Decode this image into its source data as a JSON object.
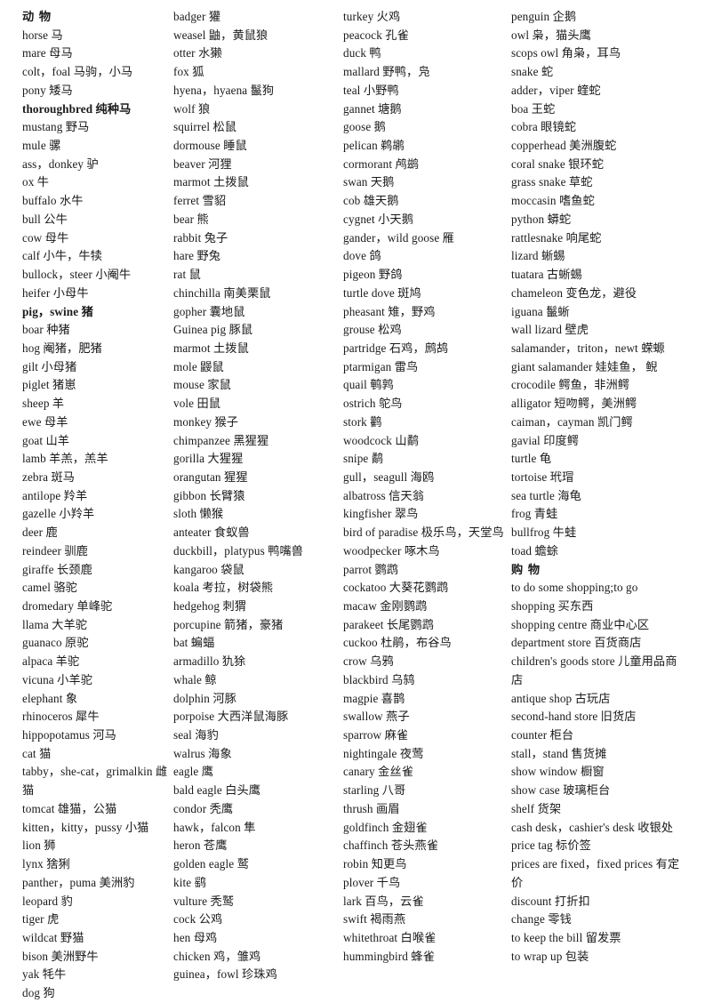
{
  "document": {
    "title": "动  物 / 购  物 English-Chinese vocabulary list",
    "section_headings": [
      "动  物",
      "购  物"
    ],
    "layout": {
      "columns": 4,
      "text_color": "#1a1a1a",
      "background": "#ffffff"
    }
  },
  "columns": [
    {
      "index": 0,
      "entries": [
        {
          "text": "动  物",
          "style": "heading"
        },
        {
          "text": "horse  马",
          "style": "normal"
        },
        {
          "text": "mare  母马",
          "style": "normal"
        },
        {
          "text": "colt，foal  马驹，小马",
          "style": "normal"
        },
        {
          "text": "pony  矮马",
          "style": "normal"
        },
        {
          "text": "thoroughbred  纯种马",
          "style": "bold"
        },
        {
          "text": "mustang  野马",
          "style": "normal"
        },
        {
          "text": "mule  骡",
          "style": "normal"
        },
        {
          "text": "ass，donkey  驴",
          "style": "normal"
        },
        {
          "text": "ox  牛",
          "style": "normal"
        },
        {
          "text": "buffalo  水牛",
          "style": "normal"
        },
        {
          "text": "bull  公牛",
          "style": "normal"
        },
        {
          "text": "cow  母牛",
          "style": "normal"
        },
        {
          "text": "calf  小牛，牛犊",
          "style": "normal"
        },
        {
          "text": "bullock，steer  小阉牛",
          "style": "normal"
        },
        {
          "text": "heifer  小母牛",
          "style": "normal"
        },
        {
          "text": "pig，swine  猪",
          "style": "bold"
        },
        {
          "text": "boar  种猪",
          "style": "normal"
        },
        {
          "text": "hog  阉猪，肥猪",
          "style": "normal"
        },
        {
          "text": "gilt  小母猪",
          "style": "normal"
        },
        {
          "text": "piglet  猪崽",
          "style": "normal"
        },
        {
          "text": "sheep  羊",
          "style": "normal"
        },
        {
          "text": "ewe  母羊",
          "style": "normal"
        },
        {
          "text": "goat  山羊",
          "style": "normal"
        },
        {
          "text": "lamb  羊羔，羔羊",
          "style": "normal"
        },
        {
          "text": "zebra  斑马",
          "style": "normal"
        },
        {
          "text": "antilope  羚羊",
          "style": "normal"
        },
        {
          "text": "gazelle  小羚羊",
          "style": "normal"
        },
        {
          "text": "deer  鹿",
          "style": "normal"
        },
        {
          "text": "reindeer  驯鹿",
          "style": "normal"
        },
        {
          "text": "giraffe  长颈鹿",
          "style": "normal"
        },
        {
          "text": "camel  骆驼",
          "style": "normal"
        },
        {
          "text": "dromedary  单峰驼",
          "style": "normal"
        },
        {
          "text": "llama  大羊驼",
          "style": "normal"
        },
        {
          "text": "guanaco  原驼",
          "style": "normal"
        },
        {
          "text": "alpaca  羊驼",
          "style": "normal"
        },
        {
          "text": "vicuna  小羊驼",
          "style": "normal"
        },
        {
          "text": "elephant  象",
          "style": "normal"
        },
        {
          "text": "rhinoceros  犀牛",
          "style": "normal"
        },
        {
          "text": "hippopotamus  河马",
          "style": "normal"
        },
        {
          "text": "cat  猫",
          "style": "normal"
        },
        {
          "text": "tabby，she-cat，grimalkin  雌猫",
          "style": "normal"
        },
        {
          "text": "tomcat  雄猫，公猫",
          "style": "normal"
        },
        {
          "text": "kitten，kitty，pussy  小猫",
          "style": "normal"
        },
        {
          "text": "lion  狮",
          "style": "normal"
        },
        {
          "text": "lynx  猞猁",
          "style": "normal"
        },
        {
          "text": "panther，puma  美洲豹",
          "style": "normal"
        },
        {
          "text": "leopard  豹",
          "style": "normal"
        },
        {
          "text": "tiger  虎",
          "style": "normal"
        },
        {
          "text": "wildcat  野猫",
          "style": "normal"
        },
        {
          "text": "bison  美洲野牛",
          "style": "normal"
        },
        {
          "text": "yak  牦牛",
          "style": "normal"
        },
        {
          "text": "dog  狗",
          "style": "normal"
        }
      ]
    },
    {
      "index": 1,
      "entries": [
        {
          "text": "badger  獾",
          "style": "normal"
        },
        {
          "text": "weasel  鼬，黄鼠狼",
          "style": "normal"
        },
        {
          "text": "otter  水獭",
          "style": "normal"
        },
        {
          "text": "fox  狐",
          "style": "normal"
        },
        {
          "text": "hyena，hyaena  鬣狗",
          "style": "normal"
        },
        {
          "text": "wolf  狼",
          "style": "normal"
        },
        {
          "text": "squirrel  松鼠",
          "style": "normal"
        },
        {
          "text": "dormouse  睡鼠",
          "style": "normal"
        },
        {
          "text": "beaver  河狸",
          "style": "normal"
        },
        {
          "text": "marmot  土拨鼠",
          "style": "normal"
        },
        {
          "text": "ferret  雪貂",
          "style": "normal"
        },
        {
          "text": "bear  熊",
          "style": "normal"
        },
        {
          "text": "rabbit  兔子",
          "style": "normal"
        },
        {
          "text": "hare  野兔",
          "style": "normal"
        },
        {
          "text": "rat  鼠",
          "style": "normal"
        },
        {
          "text": "chinchilla  南美栗鼠",
          "style": "normal"
        },
        {
          "text": "gopher  囊地鼠",
          "style": "normal"
        },
        {
          "text": "Guinea pig  豚鼠",
          "style": "normal"
        },
        {
          "text": "marmot  土拨鼠",
          "style": "normal"
        },
        {
          "text": "mole  鼹鼠",
          "style": "normal"
        },
        {
          "text": "mouse  家鼠",
          "style": "normal"
        },
        {
          "text": "vole  田鼠",
          "style": "normal"
        },
        {
          "text": "monkey  猴子",
          "style": "normal"
        },
        {
          "text": "chimpanzee  黑猩猩",
          "style": "normal"
        },
        {
          "text": "gorilla  大猩猩",
          "style": "normal"
        },
        {
          "text": "orangutan  猩猩",
          "style": "normal"
        },
        {
          "text": "gibbon  长臂猿",
          "style": "normal"
        },
        {
          "text": "sloth  懒猴",
          "style": "normal"
        },
        {
          "text": "anteater  食蚁兽",
          "style": "normal"
        },
        {
          "text": "duckbill，platypus  鸭嘴兽",
          "style": "normal"
        },
        {
          "text": "kangaroo  袋鼠",
          "style": "normal"
        },
        {
          "text": "koala  考拉，树袋熊",
          "style": "normal"
        },
        {
          "text": "hedgehog  刺猬",
          "style": "normal"
        },
        {
          "text": "porcupine  箭猪，豪猪",
          "style": "normal"
        },
        {
          "text": "bat  蝙蝠",
          "style": "normal"
        },
        {
          "text": "armadillo  犰狳",
          "style": "normal"
        },
        {
          "text": "whale  鲸",
          "style": "normal"
        },
        {
          "text": "dolphin  河豚",
          "style": "normal"
        },
        {
          "text": "porpoise  大西洋鼠海豚",
          "style": "normal"
        },
        {
          "text": "seal  海豹",
          "style": "normal"
        },
        {
          "text": "walrus  海象",
          "style": "normal"
        },
        {
          "text": "eagle  鹰",
          "style": "normal"
        },
        {
          "text": "bald eagle  白头鹰",
          "style": "normal"
        },
        {
          "text": "condor  秃鹰",
          "style": "normal"
        },
        {
          "text": "hawk，falcon  隼",
          "style": "normal"
        },
        {
          "text": "heron  苍鹰",
          "style": "normal"
        },
        {
          "text": "golden eagle  鹫",
          "style": "normal"
        },
        {
          "text": "kite  鹞",
          "style": "normal"
        },
        {
          "text": "vulture  秃鹫",
          "style": "normal"
        },
        {
          "text": "cock  公鸡",
          "style": "normal"
        },
        {
          "text": "hen  母鸡",
          "style": "normal"
        },
        {
          "text": "chicken  鸡，雏鸡",
          "style": "normal"
        },
        {
          "text": "guinea，fowl  珍珠鸡",
          "style": "normal"
        }
      ]
    },
    {
      "index": 2,
      "entries": [
        {
          "text": "turkey  火鸡",
          "style": "normal"
        },
        {
          "text": "peacock  孔雀",
          "style": "normal"
        },
        {
          "text": "duck  鸭",
          "style": "normal"
        },
        {
          "text": "mallard  野鸭，凫",
          "style": "normal"
        },
        {
          "text": "teal  小野鸭",
          "style": "normal"
        },
        {
          "text": "gannet  塘鹅",
          "style": "normal"
        },
        {
          "text": "goose  鹅",
          "style": "normal"
        },
        {
          "text": "pelican  鹈鹕",
          "style": "normal"
        },
        {
          "text": "cormorant  鸬鹚",
          "style": "normal"
        },
        {
          "text": "swan  天鹅",
          "style": "normal"
        },
        {
          "text": "cob  雄天鹅",
          "style": "normal"
        },
        {
          "text": "cygnet  小天鹅",
          "style": "normal"
        },
        {
          "text": "gander，wild goose  雁",
          "style": "normal"
        },
        {
          "text": "dove  鸽",
          "style": "normal"
        },
        {
          "text": "pigeon  野鸽",
          "style": "normal"
        },
        {
          "text": "turtle dove  斑鸠",
          "style": "normal"
        },
        {
          "text": "pheasant  雉，野鸡",
          "style": "normal"
        },
        {
          "text": "grouse  松鸡",
          "style": "normal"
        },
        {
          "text": "partridge  石鸡，鹧鸪",
          "style": "normal"
        },
        {
          "text": "ptarmigan  雷鸟",
          "style": "normal"
        },
        {
          "text": "quail  鹌鹑",
          "style": "normal"
        },
        {
          "text": "ostrich  鸵鸟",
          "style": "normal"
        },
        {
          "text": "stork  鹳",
          "style": "normal"
        },
        {
          "text": "woodcock  山鹬",
          "style": "normal"
        },
        {
          "text": "snipe  鹬",
          "style": "normal"
        },
        {
          "text": "gull，seagull  海鸥",
          "style": "normal"
        },
        {
          "text": "albatross  信天翁",
          "style": "normal"
        },
        {
          "text": "kingfisher  翠鸟",
          "style": "normal"
        },
        {
          "text": "bird of paradise  极乐鸟，天堂鸟",
          "style": "normal"
        },
        {
          "text": "woodpecker  啄木鸟",
          "style": "normal"
        },
        {
          "text": "parrot  鹦鹉",
          "style": "normal"
        },
        {
          "text": "cockatoo  大葵花鹦鹉",
          "style": "normal"
        },
        {
          "text": "macaw  金刚鹦鹉",
          "style": "normal"
        },
        {
          "text": "parakeet  长尾鹦鹉",
          "style": "normal"
        },
        {
          "text": "cuckoo  杜鹃，布谷鸟",
          "style": "normal"
        },
        {
          "text": "crow  乌鸦",
          "style": "normal"
        },
        {
          "text": "blackbird  乌鸫",
          "style": "normal"
        },
        {
          "text": "magpie  喜鹊",
          "style": "normal"
        },
        {
          "text": "swallow  燕子",
          "style": "normal"
        },
        {
          "text": "sparrow  麻雀",
          "style": "normal"
        },
        {
          "text": "nightingale  夜莺",
          "style": "normal"
        },
        {
          "text": "canary  金丝雀",
          "style": "normal"
        },
        {
          "text": "starling  八哥",
          "style": "normal"
        },
        {
          "text": "thrush  画眉",
          "style": "normal"
        },
        {
          "text": "goldfinch  金翅雀",
          "style": "normal"
        },
        {
          "text": "chaffinch  苍头燕雀",
          "style": "normal"
        },
        {
          "text": "robin  知更鸟",
          "style": "normal"
        },
        {
          "text": "plover  千鸟",
          "style": "normal"
        },
        {
          "text": "lark  百鸟，云雀",
          "style": "normal"
        },
        {
          "text": "swift  褐雨燕",
          "style": "normal"
        },
        {
          "text": "whitethroat  白喉雀",
          "style": "normal"
        },
        {
          "text": "hummingbird  蜂雀",
          "style": "normal"
        }
      ]
    },
    {
      "index": 3,
      "entries": [
        {
          "text": "penguin  企鹅",
          "style": "normal"
        },
        {
          "text": "owl  枭，猫头鹰",
          "style": "normal"
        },
        {
          "text": "scops owl  角枭，耳鸟",
          "style": "normal"
        },
        {
          "text": "snake  蛇",
          "style": "normal"
        },
        {
          "text": "adder，viper  蝰蛇",
          "style": "normal"
        },
        {
          "text": "boa  王蛇",
          "style": "normal"
        },
        {
          "text": "cobra  眼镜蛇",
          "style": "normal"
        },
        {
          "text": "copperhead  美洲腹蛇",
          "style": "normal"
        },
        {
          "text": "coral snake  银环蛇",
          "style": "normal"
        },
        {
          "text": "grass snake  草蛇",
          "style": "normal"
        },
        {
          "text": "moccasin  嗜鱼蛇",
          "style": "normal"
        },
        {
          "text": "python  蟒蛇",
          "style": "normal"
        },
        {
          "text": "rattlesnake  响尾蛇",
          "style": "normal"
        },
        {
          "text": "lizard  蜥蜴",
          "style": "normal"
        },
        {
          "text": "tuatara  古蜥蜴",
          "style": "normal"
        },
        {
          "text": "chameleon  变色龙，避役",
          "style": "normal"
        },
        {
          "text": "iguana  鬣蜥",
          "style": "normal"
        },
        {
          "text": "wall lizard  壁虎",
          "style": "normal"
        },
        {
          "text": "salamander，triton，newt  蝾螈",
          "style": "normal"
        },
        {
          "text": "giant salamander  娃娃鱼，  鲵",
          "style": "normal"
        },
        {
          "text": "crocodile  鳄鱼，非洲鳄",
          "style": "normal"
        },
        {
          "text": "alligator  短吻鳄，美洲鳄",
          "style": "normal"
        },
        {
          "text": "caiman，cayman  凯门鳄",
          "style": "normal"
        },
        {
          "text": "gavial  印度鳄",
          "style": "normal"
        },
        {
          "text": "turtle  龟",
          "style": "normal"
        },
        {
          "text": "tortoise  玳瑁",
          "style": "normal"
        },
        {
          "text": "sea turtle  海龟",
          "style": "normal"
        },
        {
          "text": "frog  青蛙",
          "style": "normal"
        },
        {
          "text": "bullfrog  牛蛙",
          "style": "normal"
        },
        {
          "text": "toad  蟾蜍",
          "style": "normal"
        },
        {
          "text": "购  物",
          "style": "heading"
        },
        {
          "text": "to do some shopping;to go shopping  买东西",
          "style": "normal"
        },
        {
          "text": "shopping centre  商业中心区",
          "style": "normal"
        },
        {
          "text": "department store  百货商店",
          "style": "normal"
        },
        {
          "text": "children's goods store  儿童用品商店",
          "style": "normal"
        },
        {
          "text": "antique shop  古玩店",
          "style": "normal"
        },
        {
          "text": "second-hand store  旧货店",
          "style": "normal"
        },
        {
          "text": "counter  柜台",
          "style": "normal"
        },
        {
          "text": "stall，stand  售货摊",
          "style": "normal"
        },
        {
          "text": "show window  橱窗",
          "style": "normal"
        },
        {
          "text": "show case  玻璃柜台",
          "style": "normal"
        },
        {
          "text": "shelf  货架",
          "style": "normal"
        },
        {
          "text": "cash desk，cashier's desk  收银处",
          "style": "normal"
        },
        {
          "text": "price tag  标价签",
          "style": "normal"
        },
        {
          "text": "prices are fixed，fixed prices  有定价",
          "style": "normal"
        },
        {
          "text": "discount  打折扣",
          "style": "normal"
        },
        {
          "text": "change  零钱",
          "style": "normal"
        },
        {
          "text": "to keep the bill  留发票",
          "style": "normal"
        },
        {
          "text": "to wrap up  包装",
          "style": "normal"
        }
      ]
    }
  ]
}
